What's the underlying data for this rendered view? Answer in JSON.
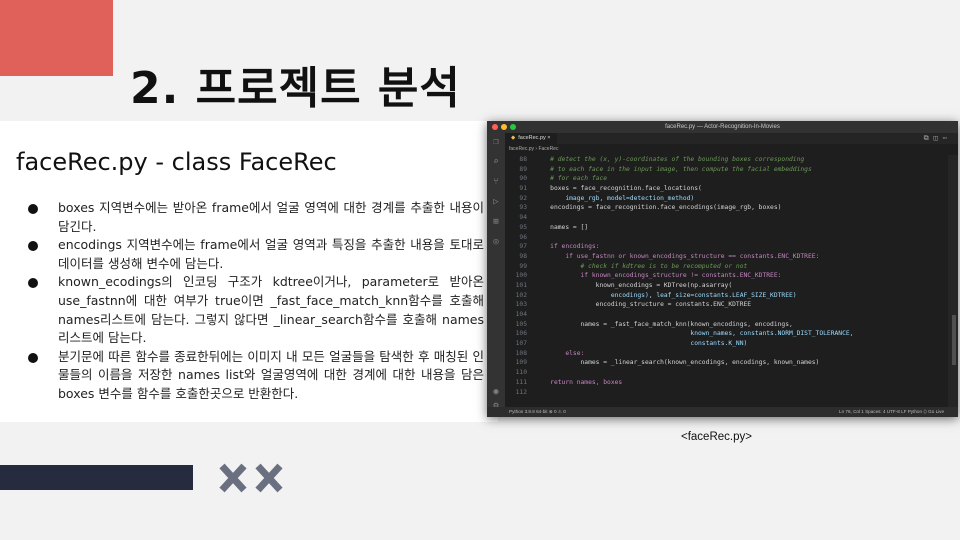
{
  "slide": {
    "title": "2. 프로젝트 분석",
    "subtitle": "faceRec.py - class FaceRec",
    "bullets": [
      "boxes 지역변수에는 받아온 frame에서 얼굴 영역에 대한 경계를 추출한 내용이 담긴다.",
      "encodings 지역변수에는 frame에서 얼굴 영역과 특징을 추출한 내용을 토대로 데이터를 생성해 변수에 담는다.",
      "known_ecodings의 인코딩 구조가 kdtree이거나, parameter로 받아온 use_fastnn에 대한 여부가 true이면 _fast_face_match_knn함수를 호출해 names리스트에 담는다. 그렇지 않다면 _linear_search함수를 호출해 names리스트에 담는다.",
      "분기문에 따른 함수를 종료한뒤에는 이미지 내 모든 얼굴들을 탐색한 후 매칭된 인물들의 이름을 저장한 names list와 얼굴영역에 대한 경계에 대한 내용을 담은 boxes 변수를 함수를 호출한곳으로 반환한다."
    ],
    "caption": "<faceRec.py>",
    "colors": {
      "accent_red": "#e0605a",
      "navy": "#262b40",
      "x_marks": "#6b7080"
    }
  },
  "editor": {
    "window_title": "faceRec.py — Actor-Recognition-In-Movies",
    "tab_label": "faceRec.py",
    "tab_close": "×",
    "breadcrumb": "faceRec.py  ›  FaceRec",
    "status_left": "Python 3.8.8 64-bit   ⊗ 0 ⚠ 0",
    "status_right": "Ln 76, Col 1   Spaces: 4   UTF-8   LF   Python   ⟨⟩ Go Live",
    "code_lines": [
      {
        "n": "88",
        "text": "    # detect the (x, y)-coordinates of the bounding boxes corresponding",
        "cls": "cm"
      },
      {
        "n": "89",
        "text": "    # to each face in the input image, then compute the facial embeddings",
        "cls": "cm"
      },
      {
        "n": "90",
        "text": "    # for each face",
        "cls": "cm"
      },
      {
        "n": "91",
        "text": "    boxes = face_recognition.face_locations(",
        "cls": "t"
      },
      {
        "n": "92",
        "text": "        image_rgb, model=detection_method)",
        "cls": "v"
      },
      {
        "n": "93",
        "text": "    encodings = face_recognition.face_encodings(image_rgb, boxes)",
        "cls": "t"
      },
      {
        "n": "94",
        "text": "",
        "cls": "t"
      },
      {
        "n": "95",
        "text": "    names = []",
        "cls": "t"
      },
      {
        "n": "96",
        "text": "",
        "cls": "t"
      },
      {
        "n": "97",
        "text": "    if encodings:",
        "cls": "pk"
      },
      {
        "n": "98",
        "text": "        if use_fastnn or known_encodings_structure == constants.ENC_KDTREE:",
        "cls": "pk"
      },
      {
        "n": "99",
        "text": "            # check if kdtree is to be recomputed or not",
        "cls": "cm"
      },
      {
        "n": "100",
        "text": "            if known_encodings_structure != constants.ENC_KDTREE:",
        "cls": "pk"
      },
      {
        "n": "101",
        "text": "                known_encodings = KDTree(np.asarray(",
        "cls": "t"
      },
      {
        "n": "102",
        "text": "                    encodings), leaf_size=constants.LEAF_SIZE_KDTREE)",
        "cls": "v"
      },
      {
        "n": "103",
        "text": "                encoding_structure = constants.ENC_KDTREE",
        "cls": "t"
      },
      {
        "n": "104",
        "text": "",
        "cls": "t"
      },
      {
        "n": "105",
        "text": "            names = _fast_face_match_knn(known_encodings, encodings,",
        "cls": "t"
      },
      {
        "n": "106",
        "text": "                                         known_names, constants.NORM_DIST_TOLERANCE,",
        "cls": "v"
      },
      {
        "n": "107",
        "text": "                                         constants.K_NN)",
        "cls": "v"
      },
      {
        "n": "108",
        "text": "        else:",
        "cls": "pk"
      },
      {
        "n": "109",
        "text": "            names = _linear_search(known_encodings, encodings, known_names)",
        "cls": "t"
      },
      {
        "n": "110",
        "text": "",
        "cls": "t"
      },
      {
        "n": "111",
        "text": "    return names, boxes",
        "cls": "pk"
      },
      {
        "n": "112",
        "text": "",
        "cls": "t"
      }
    ]
  }
}
